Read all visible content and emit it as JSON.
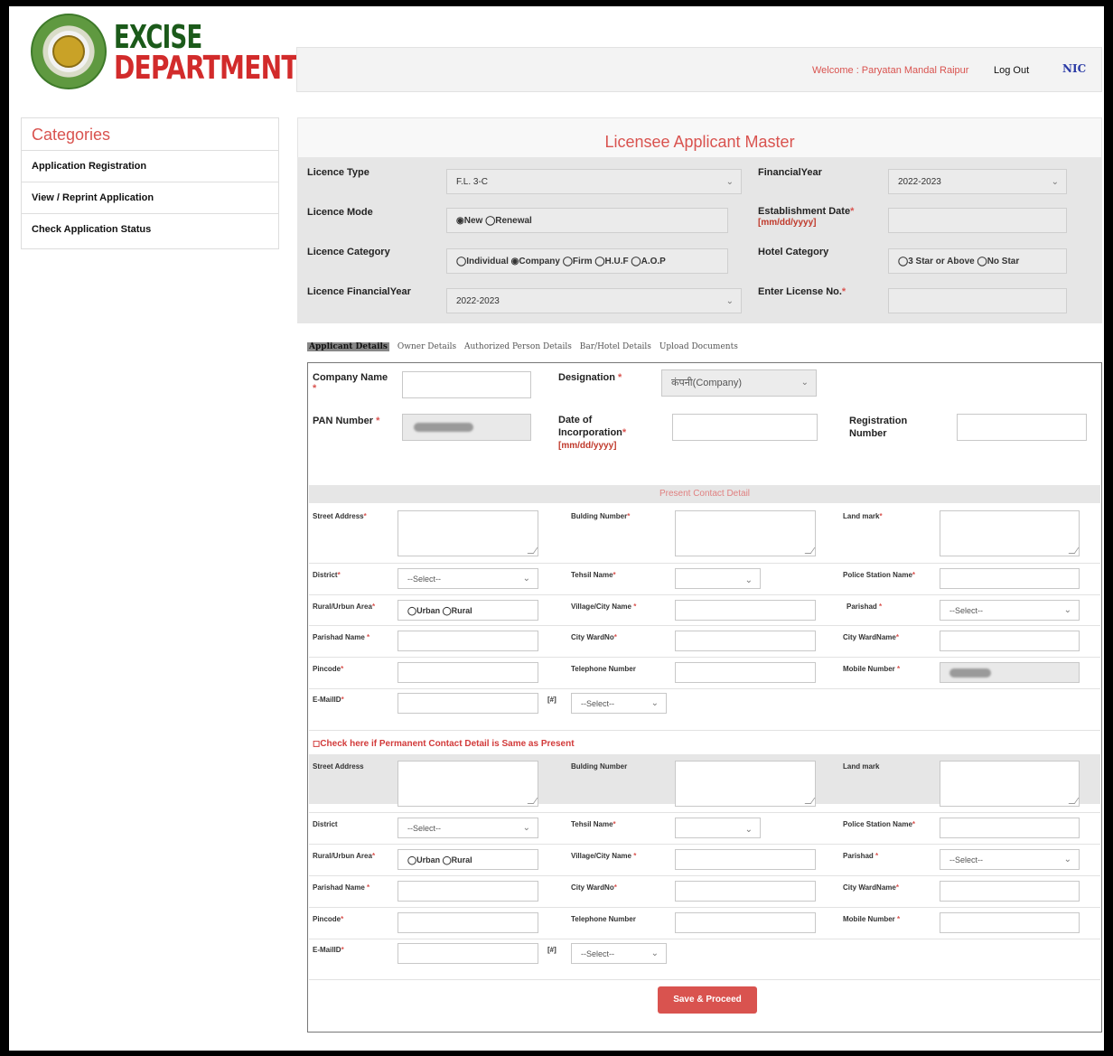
{
  "brand": {
    "line1": "EXCISE",
    "line2": "DEPARTMENT"
  },
  "topbar": {
    "welcome": "Welcome : Paryatan Mandal Raipur",
    "logout": "Log Out",
    "nic": "NIC"
  },
  "sidebar": {
    "title": "Categories",
    "items": [
      "Application Registration",
      "View / Reprint Application",
      "Check Application Status"
    ]
  },
  "main": {
    "title": "Licensee Applicant Master"
  },
  "top": {
    "licence_type_label": "Licence Type",
    "licence_type_value": "F.L. 3-C",
    "fy_label": "FinancialYear",
    "fy_value": "2022-2023",
    "mode_label": "Licence Mode",
    "mode_options": "◉New ◯Renewal",
    "est_label": "Establishment Date",
    "est_format": "[mm/dd/yyyy]",
    "cat_label": "Licence Category",
    "cat_options": "◯Individual ◉Company ◯Firm ◯H.U.F ◯A.O.P",
    "hotel_label": "Hotel Category",
    "hotel_options": "◯3 Star or Above ◯No Star",
    "lfy_label": "Licence FinancialYear",
    "lfy_value": "2022-2023",
    "lic_no_label": "Enter License No."
  },
  "tabs": [
    "Applicant Details",
    "Owner Details",
    "Authorized Person Details",
    "Bar/Hotel Details",
    "Upload Documents"
  ],
  "applicant": {
    "company_label": "Company Name",
    "designation_label": "Designation",
    "designation_value": "कंपनी(Company)",
    "pan_label": "PAN Number",
    "doi_label1": "Date of",
    "doi_label2": "Incorporation",
    "doi_format": "[mm/dd/yyyy]",
    "reg_label1": "Registration",
    "reg_label2": "Number"
  },
  "present": {
    "band": "Present Contact Detail",
    "street": "Street Address",
    "building": "Bulding Number",
    "landmark": "Land mark",
    "district": "District",
    "select": "--Select--",
    "tehsil": "Tehsil Name",
    "police": "Police Station Name",
    "area": "Rural/Urbun Area",
    "area_options": "◯Urban ◯Rural",
    "village": "Village/City Name",
    "parishad": "Parishad",
    "parishad_name": "Parishad Name",
    "ward_no": "City WardNo",
    "ward_name": "City WardName",
    "pincode": "Pincode",
    "telephone": "Telephone Number",
    "mobile": "Mobile Number",
    "email": "E-MailID",
    "hash": "[#]"
  },
  "check_text": "◻Check here if Permanent Contact Detail is Same as Present",
  "save_label": "Save & Proceed"
}
